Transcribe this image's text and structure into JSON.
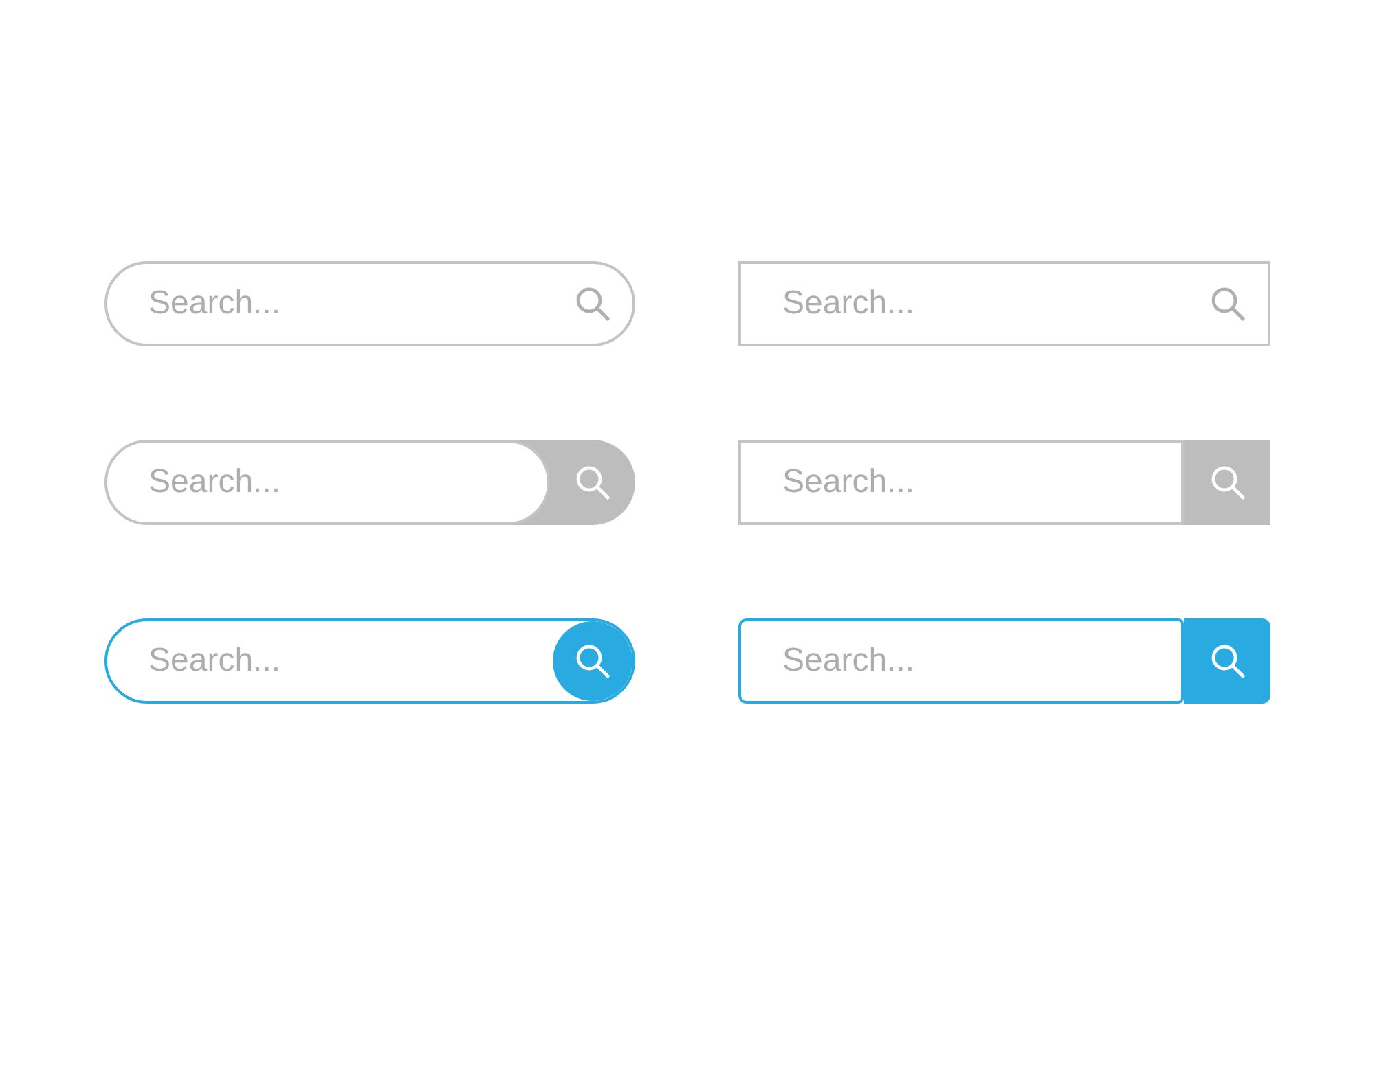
{
  "search_bars": [
    {
      "kind": "pill-icon",
      "placeholder": "Search..."
    },
    {
      "kind": "rect-icon",
      "placeholder": "Search..."
    },
    {
      "kind": "pill-gray-button",
      "placeholder": "Search..."
    },
    {
      "kind": "rect-gray-button",
      "placeholder": "Search..."
    },
    {
      "kind": "pill-blue-button",
      "placeholder": "Search..."
    },
    {
      "kind": "rect-blue-button",
      "placeholder": "Search..."
    }
  ]
}
